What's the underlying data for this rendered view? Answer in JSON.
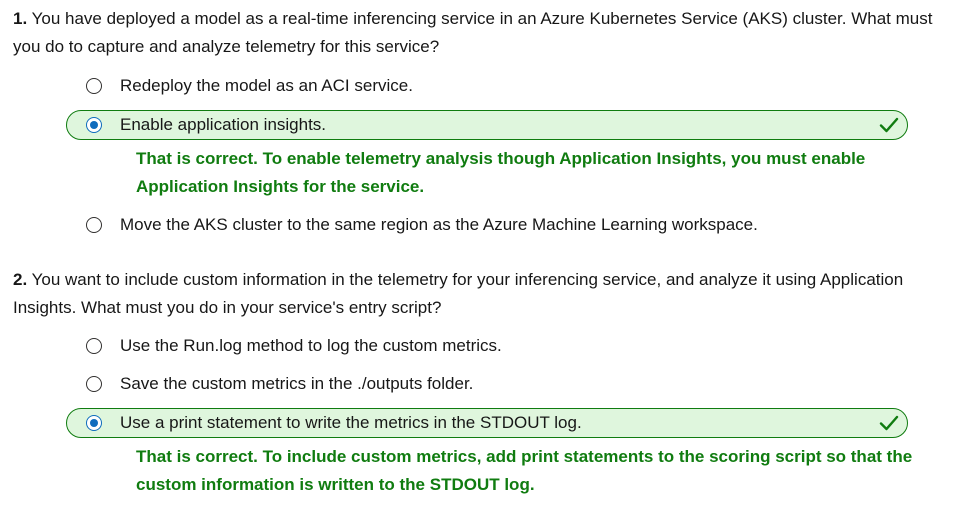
{
  "questions": [
    {
      "number": "1.",
      "text": " You have deployed a model as a real-time inferencing service in an Azure Kubernetes Service (AKS) cluster. What must you do to capture and analyze telemetry for this service?",
      "options": [
        {
          "label": "Redeploy the model as an ACI service.",
          "selected": false,
          "correct": false
        },
        {
          "label": "Enable application insights.",
          "selected": true,
          "correct": true
        },
        {
          "label": "Move the AKS cluster to the same region as the Azure Machine Learning workspace.",
          "selected": false,
          "correct": false
        }
      ],
      "feedback": "That is correct. To enable telemetry analysis though Application Insights, you must enable Application Insights for the service."
    },
    {
      "number": "2.",
      "text": " You want to include custom information in the telemetry for your inferencing service, and analyze it using Application Insights. What must you do in your service's entry script?",
      "options": [
        {
          "label": "Use the Run.log method to log the custom metrics.",
          "selected": false,
          "correct": false
        },
        {
          "label": "Save the custom metrics in the ./outputs folder.",
          "selected": false,
          "correct": false
        },
        {
          "label": "Use a print statement to write the metrics in the STDOUT log.",
          "selected": true,
          "correct": true
        }
      ],
      "feedback": "That is correct. To include custom metrics, add print statements to the scoring script so that the custom information is written to the STDOUT log."
    }
  ],
  "icons": {
    "radio_unselected": "radio-empty-icon",
    "radio_selected": "radio-filled-icon",
    "correct": "checkmark-icon"
  },
  "colors": {
    "correct_green": "#107c10",
    "correct_bg": "#dff6dd",
    "radio_blue": "#0f6cbd",
    "text": "#171717"
  }
}
